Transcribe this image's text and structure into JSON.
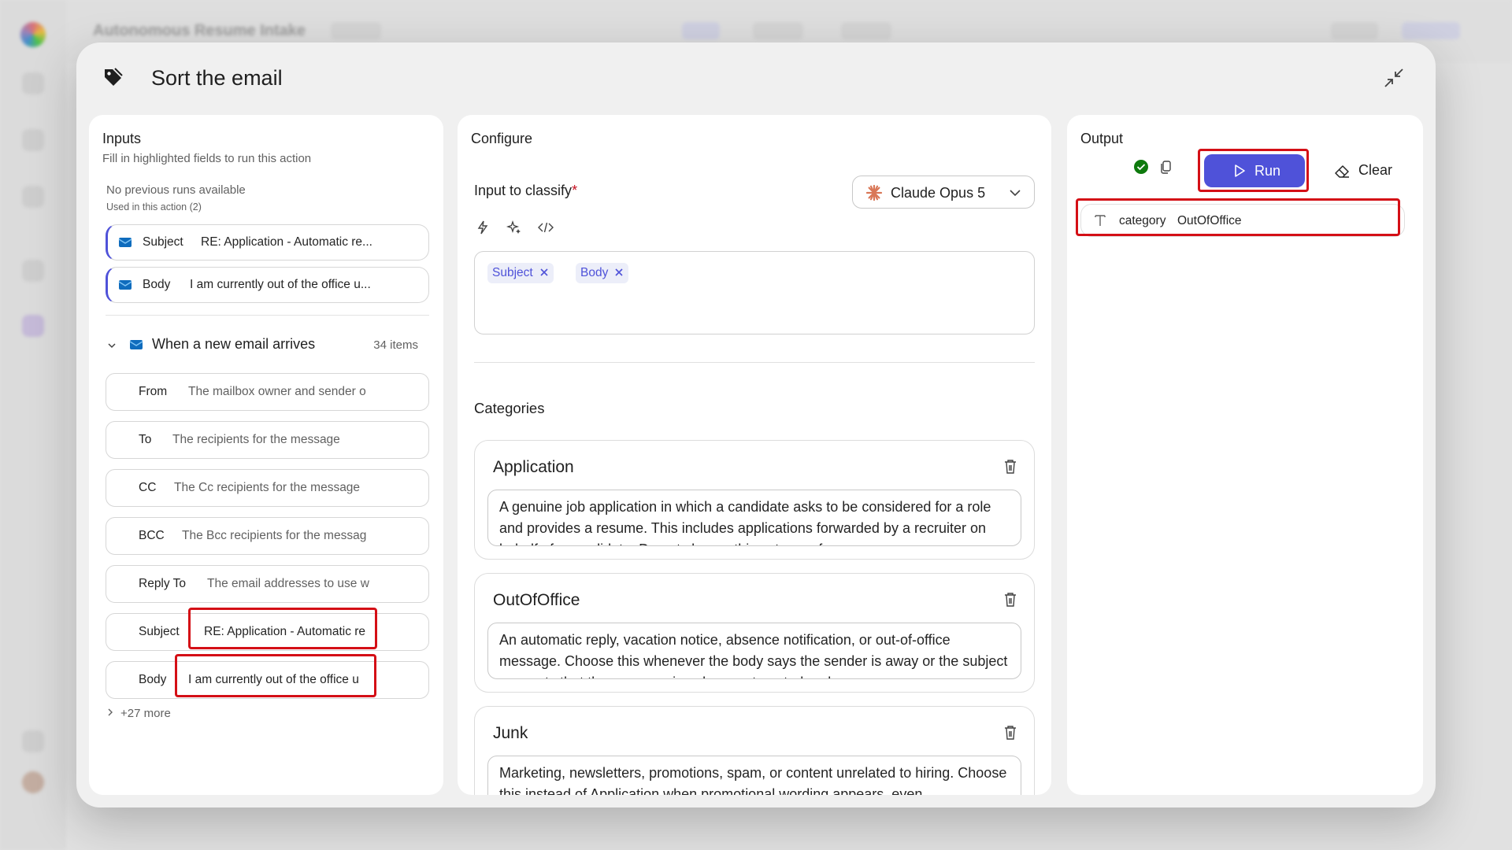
{
  "background": {
    "app_title": "Autonomous Resume Intake"
  },
  "modal": {
    "title": "Sort the email"
  },
  "inputs": {
    "title": "Inputs",
    "subtitle": "Fill in highlighted fields to run this action",
    "no_previous_runs": "No previous runs available",
    "used_in_action": "Used in this action (2)",
    "used_fields": [
      {
        "label": "Subject",
        "value": "RE: Application - Automatic re..."
      },
      {
        "label": "Body",
        "value": "I am currently out of the office u..."
      }
    ],
    "group": {
      "title": "When a new email arrives",
      "count": "34 items"
    },
    "group_fields": [
      {
        "label": "From",
        "value": "The mailbox owner and sender o"
      },
      {
        "label": "To",
        "value": "The recipients for the message"
      },
      {
        "label": "CC",
        "value": "The Cc recipients for the message"
      },
      {
        "label": "BCC",
        "value": "The Bcc recipients for the messag"
      },
      {
        "label": "Reply To",
        "value": "The email addresses to use w"
      },
      {
        "label": "Subject",
        "value": "RE: Application - Automatic re"
      },
      {
        "label": "Body",
        "value": "I am currently out of the office u"
      }
    ],
    "more": "+27 more"
  },
  "configure": {
    "title": "Configure",
    "input_label": "Input to classify",
    "required_mark": "*",
    "model": "Claude Opus 5",
    "chips": [
      "Subject",
      "Body"
    ],
    "categories_title": "Categories",
    "categories": [
      {
        "name": "Application",
        "description": "A genuine job application in which a candidate asks to be considered for a role and provides a resume. This includes applications forwarded by a recruiter on behalf of a candidate. Do not choose this category for"
      },
      {
        "name": "OutOfOffice",
        "description": "An automatic reply, vacation notice, absence notification, or out-of-office message. Choose this whenever the body says the sender is away or the subject suggests that the message is only an automated reply"
      },
      {
        "name": "Junk",
        "description": "Marketing, newsletters, promotions, spam, or content unrelated to hiring. Choose this instead of Application when promotional wording appears, even"
      }
    ]
  },
  "output": {
    "title": "Output",
    "run_label": "Run",
    "clear_label": "Clear",
    "result_key": "category",
    "result_value": "OutOfOffice"
  },
  "colors": {
    "accent": "#4f52d9",
    "highlight": "#d40f16",
    "success": "#0e7a0d"
  }
}
